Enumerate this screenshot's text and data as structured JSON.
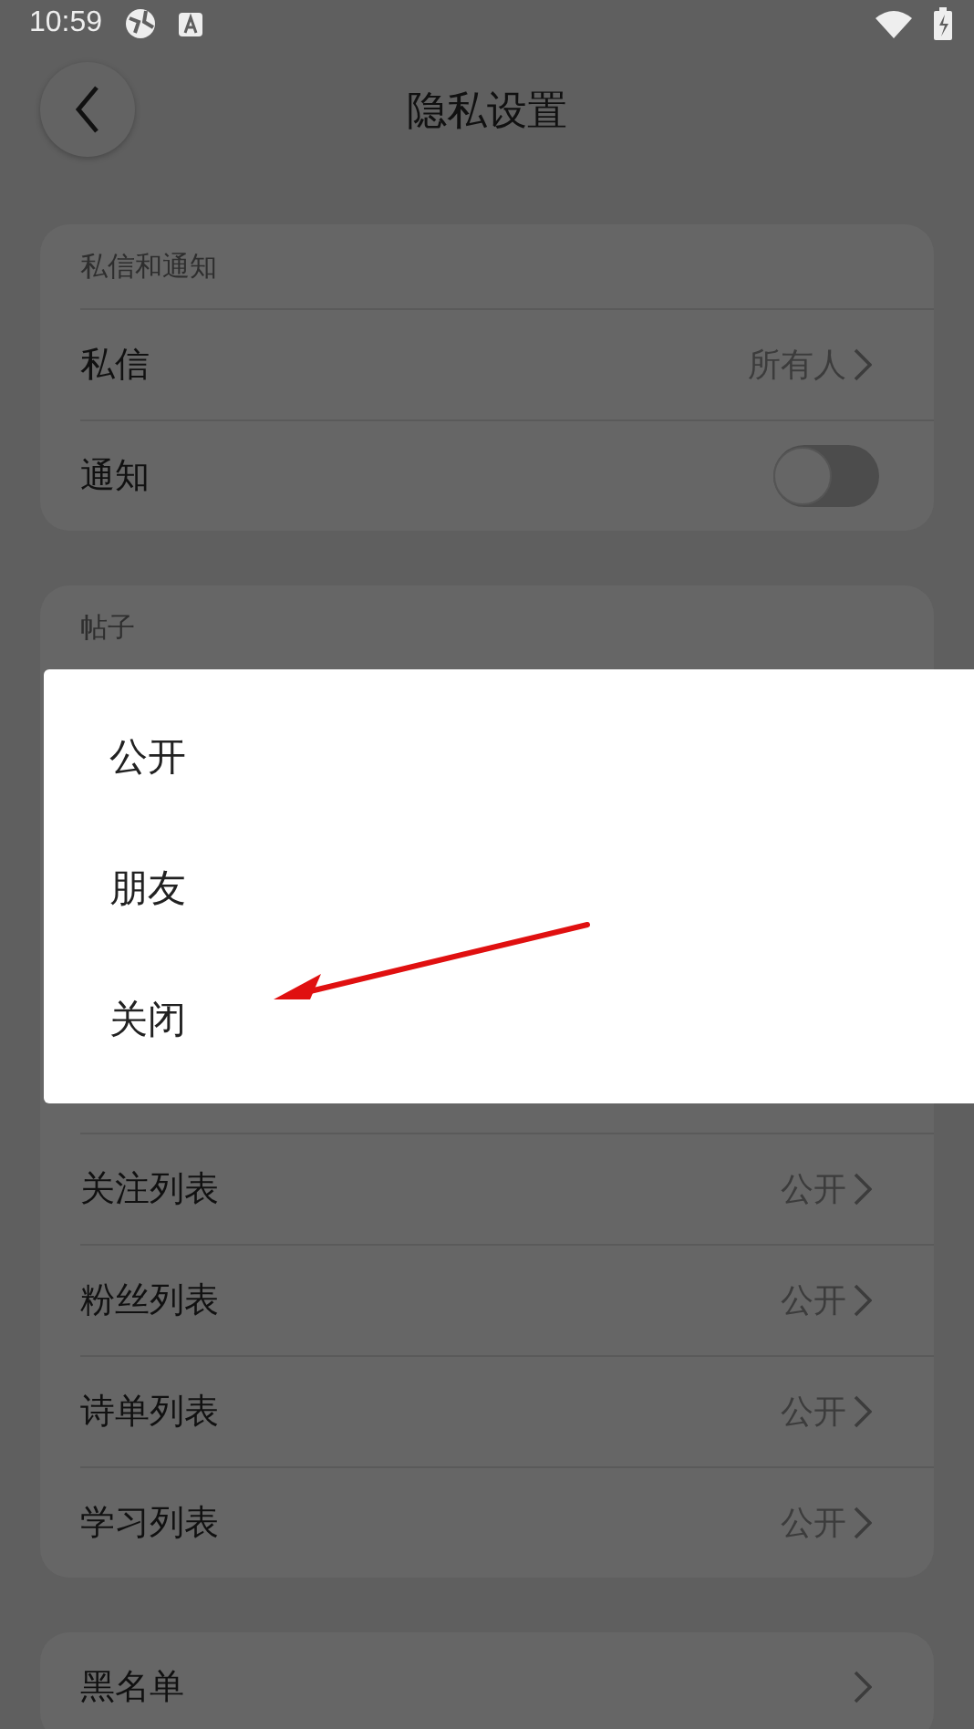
{
  "status_bar": {
    "time": "10:59"
  },
  "header": {
    "title": "隐私设置"
  },
  "sections": [
    {
      "title": "私信和通知",
      "rows": [
        {
          "kind": "link",
          "label": "私信",
          "value": "所有人"
        },
        {
          "kind": "toggle",
          "label": "通知",
          "on": false
        }
      ]
    },
    {
      "title": "帖子",
      "popup_menu": {
        "items": [
          "公开",
          "朋友",
          "关闭"
        ]
      },
      "rows": [
        {
          "kind": "link",
          "label": "关注列表",
          "value": "公开"
        },
        {
          "kind": "link",
          "label": "粉丝列表",
          "value": "公开"
        },
        {
          "kind": "link",
          "label": "诗单列表",
          "value": "公开"
        },
        {
          "kind": "link",
          "label": "学习列表",
          "value": "公开"
        }
      ]
    },
    {
      "rows": [
        {
          "kind": "link",
          "label": "黑名单"
        }
      ]
    }
  ]
}
